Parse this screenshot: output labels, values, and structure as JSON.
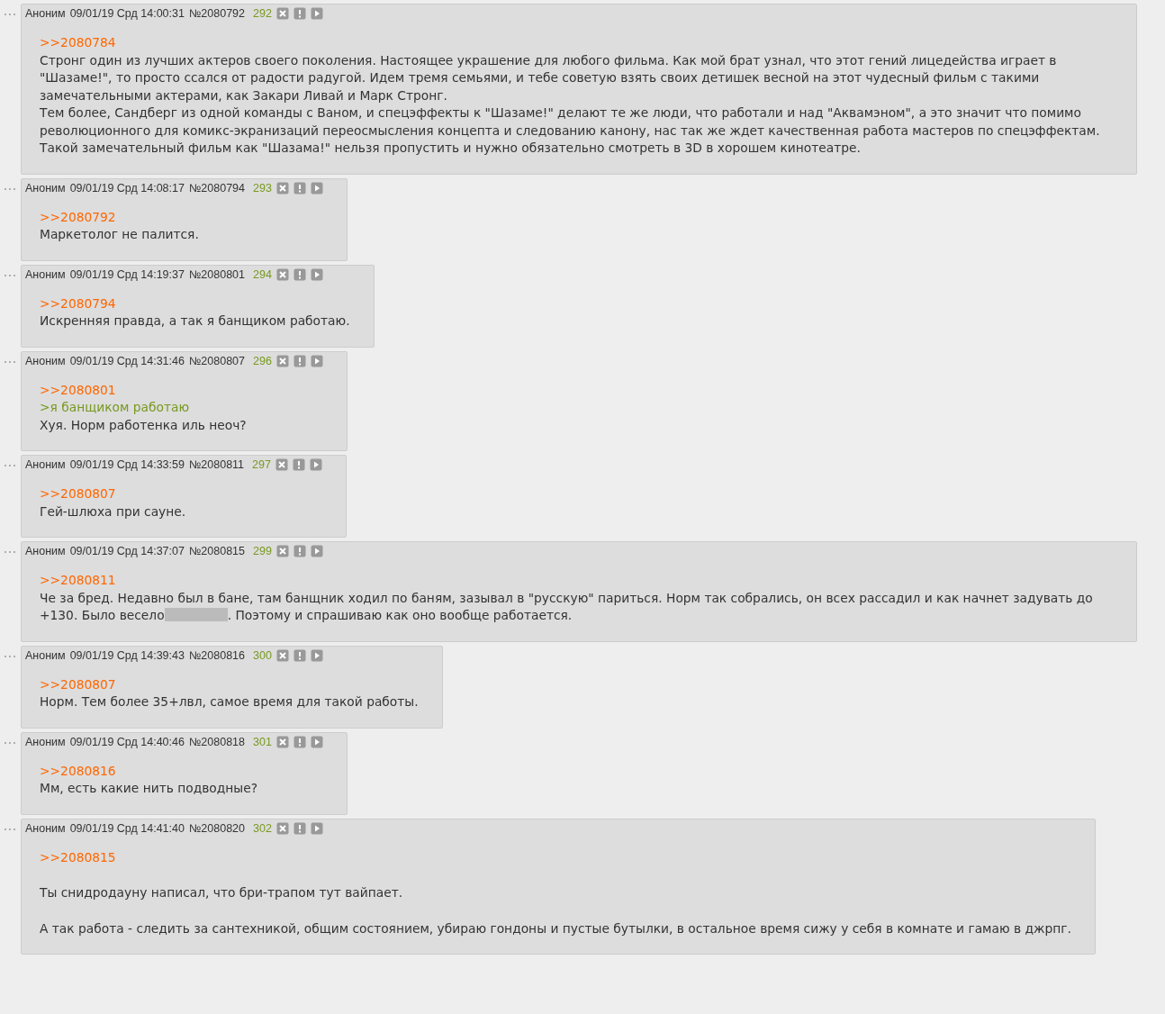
{
  "posts": [
    {
      "author": "Аноним",
      "date": "09/01/19 Срд 14:00:31",
      "number": "№2080792",
      "index": "292",
      "lines": [
        {
          "kind": "reply",
          "text": ">>2080784"
        },
        {
          "kind": "text",
          "text": "Стронг один из лучших актеров своего поколения. Настоящее украшение для любого фильма. Как мой брат узнал, что этот гений лицедейства играет в \"Шазаме!\", то просто ссался от радости радугой. Идем тремя семьями, и тебе советую взять своих детишек весной на этот чудесный фильм с такими замечательными актерами, как Закари Ливай и Марк Стронг."
        },
        {
          "kind": "text",
          "text": "Тем более, Сандберг из одной команды с Ваном, и спецэффекты к \"Шазаме!\" делают те же люди, что работали и над \"Аквамэном\", а это значит что помимо революционного для комикс-экранизаций переосмысления концепта и следованию канону, нас так же ждет качественная работа мастеров по спецэффектам. Такой замечательный фильм как \"Шазама!\" нельзя пропустить и нужно обязательно смотреть в 3D в хорошем кинотеатре."
        }
      ]
    },
    {
      "author": "Аноним",
      "date": "09/01/19 Срд 14:08:17",
      "number": "№2080794",
      "index": "293",
      "lines": [
        {
          "kind": "reply",
          "text": ">>2080792"
        },
        {
          "kind": "text",
          "text": "Маркетолог не палится."
        }
      ]
    },
    {
      "author": "Аноним",
      "date": "09/01/19 Срд 14:19:37",
      "number": "№2080801",
      "index": "294",
      "lines": [
        {
          "kind": "reply",
          "text": ">>2080794"
        },
        {
          "kind": "text",
          "text": "Искренняя правда, а так я банщиком работаю."
        }
      ]
    },
    {
      "author": "Аноним",
      "date": "09/01/19 Срд 14:31:46",
      "number": "№2080807",
      "index": "296",
      "lines": [
        {
          "kind": "reply",
          "text": ">>2080801"
        },
        {
          "kind": "quote",
          "text": ">я банщиком работаю"
        },
        {
          "kind": "text",
          "text": "Хуя. Норм работенка иль неоч?"
        }
      ]
    },
    {
      "author": "Аноним",
      "date": "09/01/19 Срд 14:33:59",
      "number": "№2080811",
      "index": "297",
      "lines": [
        {
          "kind": "reply",
          "text": ">>2080807"
        },
        {
          "kind": "text",
          "text": "Гей-шлюха при сауне."
        }
      ]
    },
    {
      "author": "Аноним",
      "date": "09/01/19 Срд 14:37:07",
      "number": "№2080815",
      "index": "299",
      "lines": [
        {
          "kind": "reply",
          "text": ">>2080811"
        },
        {
          "kind": "spoilered",
          "before": "Че за бред. Недавно был в бане, там банщник ходил по баням, зазывал в \"русскую\" париться. Норм так собрались, он всех рассадил и как начнет задувать до +130. Было весело",
          "after": ". Поэтому и спрашиваю как оно вообще работается."
        }
      ]
    },
    {
      "author": "Аноним",
      "date": "09/01/19 Срд 14:39:43",
      "number": "№2080816",
      "index": "300",
      "lines": [
        {
          "kind": "reply",
          "text": ">>2080807"
        },
        {
          "kind": "text",
          "text": "Норм. Тем более 35+лвл, самое время для такой работы."
        }
      ]
    },
    {
      "author": "Аноним",
      "date": "09/01/19 Срд 14:40:46",
      "number": "№2080818",
      "index": "301",
      "lines": [
        {
          "kind": "reply",
          "text": ">>2080816"
        },
        {
          "kind": "text",
          "text": "Мм, есть какие нить подводные?"
        }
      ]
    },
    {
      "author": "Аноним",
      "date": "09/01/19 Срд 14:41:40",
      "number": "№2080820",
      "index": "302",
      "lines": [
        {
          "kind": "reply",
          "text": ">>2080815"
        },
        {
          "kind": "para",
          "text": "Ты снидродауну написал, что бри-трапом тут вайпает."
        },
        {
          "kind": "para",
          "text": "А так работа - следить за сантехникой, общим состоянием, убираю гондоны и пустые бутылки, в остальное время сижу у себя в комнате и гамаю в джрпг."
        }
      ]
    }
  ]
}
